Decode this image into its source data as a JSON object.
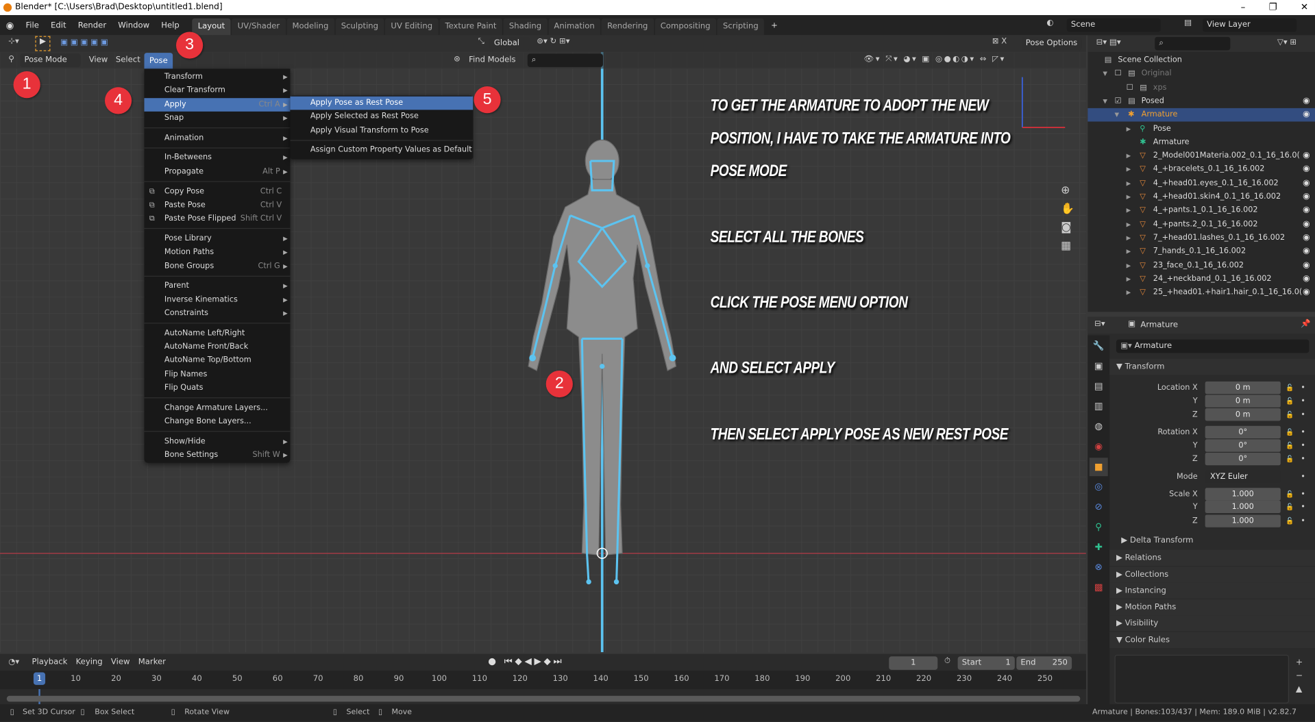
{
  "window": {
    "title": "Blender* [C:\\Users\\Brad\\Desktop\\untitled1.blend]",
    "controls": [
      "–",
      "❐",
      "✕"
    ]
  },
  "topbar": {
    "menus": [
      "File",
      "Edit",
      "Render",
      "Window",
      "Help"
    ],
    "workspaces": [
      "Layout",
      "UV/Shader",
      "Modeling",
      "Sculpting",
      "UV Editing",
      "Texture Paint",
      "Shading",
      "Animation",
      "Rendering",
      "Compositing",
      "Scripting"
    ],
    "active_workspace": "Layout",
    "add_tab": "+",
    "scene": "Scene",
    "view_layer": "View Layer"
  },
  "viewport_header": {
    "transform_orientation": "Global",
    "pose_options": "Pose Options",
    "mode": "Pose Mode",
    "menus": [
      "View",
      "Select",
      "Pose"
    ],
    "active_menu": "Pose",
    "find_models": "Find Models",
    "search_placeholder": ""
  },
  "pose_menu": {
    "items": [
      {
        "label": "Transform",
        "submenu": true
      },
      {
        "label": "Clear Transform",
        "submenu": true
      },
      {
        "label": "Apply",
        "shortcut": "Ctrl A",
        "submenu": true,
        "highlighted": true
      },
      {
        "label": "Snap",
        "submenu": true
      },
      {
        "sep": true
      },
      {
        "label": "Animation",
        "submenu": true
      },
      {
        "sep": true
      },
      {
        "label": "In-Betweens",
        "submenu": true
      },
      {
        "label": "Propagate",
        "shortcut": "Alt P",
        "submenu": true
      },
      {
        "sep": true
      },
      {
        "label": "Copy Pose",
        "shortcut": "Ctrl C",
        "icon": "copy-icon"
      },
      {
        "label": "Paste Pose",
        "shortcut": "Ctrl V",
        "icon": "paste-icon"
      },
      {
        "label": "Paste Pose Flipped",
        "shortcut": "Shift Ctrl V",
        "icon": "paste-flipped-icon"
      },
      {
        "sep": true
      },
      {
        "label": "Pose Library",
        "submenu": true
      },
      {
        "label": "Motion Paths",
        "submenu": true
      },
      {
        "label": "Bone Groups",
        "shortcut": "Ctrl G",
        "submenu": true
      },
      {
        "sep": true
      },
      {
        "label": "Parent",
        "submenu": true
      },
      {
        "label": "Inverse Kinematics",
        "submenu": true
      },
      {
        "label": "Constraints",
        "submenu": true
      },
      {
        "sep": true
      },
      {
        "label": "AutoName Left/Right"
      },
      {
        "label": "AutoName Front/Back"
      },
      {
        "label": "AutoName Top/Bottom"
      },
      {
        "label": "Flip Names"
      },
      {
        "label": "Flip Quats"
      },
      {
        "sep": true
      },
      {
        "label": "Change Armature Layers..."
      },
      {
        "label": "Change Bone Layers..."
      },
      {
        "sep": true
      },
      {
        "label": "Show/Hide",
        "submenu": true
      },
      {
        "label": "Bone Settings",
        "shortcut": "Shift W",
        "submenu": true
      }
    ]
  },
  "apply_submenu": {
    "items": [
      {
        "label": "Apply Pose as Rest Pose",
        "highlighted": true
      },
      {
        "label": "Apply Selected as Rest Pose"
      },
      {
        "label": "Apply Visual Transform to Pose"
      },
      {
        "sep": true
      },
      {
        "label": "Assign Custom Property Values as Default"
      }
    ]
  },
  "annotations": {
    "notes": [
      "To get the armature to adopt the new",
      "position, I have to take the armature into",
      "pose mode",
      "Select all the bones",
      "Click the pose menu option",
      "and select apply",
      "then select apply pose as new rest pose"
    ],
    "badges": [
      "1",
      "2",
      "3",
      "4",
      "5"
    ],
    "badge_color": "#e8323a"
  },
  "outliner": {
    "search_placeholder": "",
    "rows": [
      {
        "label": "Scene Collection",
        "indent": 0,
        "icon": "collection-icon"
      },
      {
        "label": "Original",
        "indent": 1,
        "icon": "collection-icon",
        "checkbox": false,
        "dim": true,
        "expand": "▼"
      },
      {
        "label": "xps",
        "indent": 2,
        "icon": "collection-icon",
        "checkbox": false,
        "dim": true
      },
      {
        "label": "Posed",
        "indent": 1,
        "icon": "collection-icon",
        "checkbox": true,
        "eye": true,
        "expand": "▼"
      },
      {
        "label": "Armature",
        "indent": 2,
        "icon": "armature-icon",
        "selected": true,
        "eye": true,
        "expand": "▼"
      },
      {
        "label": "Pose",
        "indent": 3,
        "icon": "pose-icon",
        "expand": "▶"
      },
      {
        "label": "Armature",
        "indent": 3,
        "icon": "armature-data-icon"
      },
      {
        "label": "2_Model001Materia.002_0.1_16_16.0(",
        "indent": 3,
        "icon": "mesh-icon",
        "eye": true,
        "expand": "▶"
      },
      {
        "label": "4_+bracelets_0.1_16_16.002",
        "indent": 3,
        "icon": "mesh-icon",
        "eye": true,
        "expand": "▶"
      },
      {
        "label": "4_+head01.eyes_0.1_16_16.002",
        "indent": 3,
        "icon": "mesh-icon",
        "eye": true,
        "expand": "▶"
      },
      {
        "label": "4_+head01.skin4_0.1_16_16.002",
        "indent": 3,
        "icon": "mesh-icon",
        "eye": true,
        "expand": "▶"
      },
      {
        "label": "4_+pants.1_0.1_16_16.002",
        "indent": 3,
        "icon": "mesh-icon",
        "eye": true,
        "expand": "▶"
      },
      {
        "label": "4_+pants.2_0.1_16_16.002",
        "indent": 3,
        "icon": "mesh-icon",
        "eye": true,
        "expand": "▶"
      },
      {
        "label": "7_+head01.lashes_0.1_16_16.002",
        "indent": 3,
        "icon": "mesh-icon",
        "eye": true,
        "expand": "▶"
      },
      {
        "label": "7_hands_0.1_16_16.002",
        "indent": 3,
        "icon": "mesh-icon",
        "eye": true,
        "expand": "▶"
      },
      {
        "label": "23_face_0.1_16_16.002",
        "indent": 3,
        "icon": "mesh-icon",
        "eye": true,
        "expand": "▶"
      },
      {
        "label": "24_+neckband_0.1_16_16.002",
        "indent": 3,
        "icon": "mesh-icon",
        "eye": true,
        "expand": "▶"
      },
      {
        "label": "25_+head01.+hair1.hair_0.1_16_16.0(",
        "indent": 3,
        "icon": "mesh-icon",
        "eye": true,
        "expand": "▶"
      }
    ]
  },
  "properties": {
    "header": "Armature",
    "object_name": "Armature",
    "transform_label": "Transform",
    "fields": [
      {
        "label": "Location X",
        "value": "0 m"
      },
      {
        "label": "Y",
        "value": "0 m"
      },
      {
        "label": "Z",
        "value": "0 m"
      },
      {
        "label": "Rotation X",
        "value": "0°"
      },
      {
        "label": "Y",
        "value": "0°"
      },
      {
        "label": "Z",
        "value": "0°"
      },
      {
        "label": "Mode",
        "value": "XYZ Euler"
      },
      {
        "label": "Scale X",
        "value": "1.000"
      },
      {
        "label": "Y",
        "value": "1.000"
      },
      {
        "label": "Z",
        "value": "1.000"
      }
    ],
    "delta": "Delta Transform",
    "sections": [
      {
        "label": "Relations",
        "open": false
      },
      {
        "label": "Collections",
        "open": false
      },
      {
        "label": "Instancing",
        "open": false
      },
      {
        "label": "Motion Paths",
        "open": false
      },
      {
        "label": "Visibility",
        "open": false
      },
      {
        "label": "Color Rules",
        "open": true
      }
    ]
  },
  "timeline": {
    "menus": [
      "Playback",
      "Keying",
      "View",
      "Marker"
    ],
    "current_frame": "1",
    "start_label": "Start",
    "start": "1",
    "end_label": "End",
    "end": "250",
    "ticks": [
      1,
      10,
      20,
      30,
      40,
      50,
      60,
      70,
      80,
      90,
      100,
      110,
      120,
      130,
      140,
      150,
      160,
      170,
      180,
      190,
      200,
      210,
      220,
      230,
      240,
      250
    ]
  },
  "statusbar": {
    "hints": [
      "Set 3D Cursor",
      "Box Select",
      "Rotate View",
      "Select",
      "Move"
    ],
    "info": "Armature | Bones:103/437 | Mem: 189.0 MiB | v2.82.7"
  },
  "colors": {
    "accent": "#4772b3",
    "bone": "#5cc3f0",
    "selected_orange": "#f0a030"
  }
}
